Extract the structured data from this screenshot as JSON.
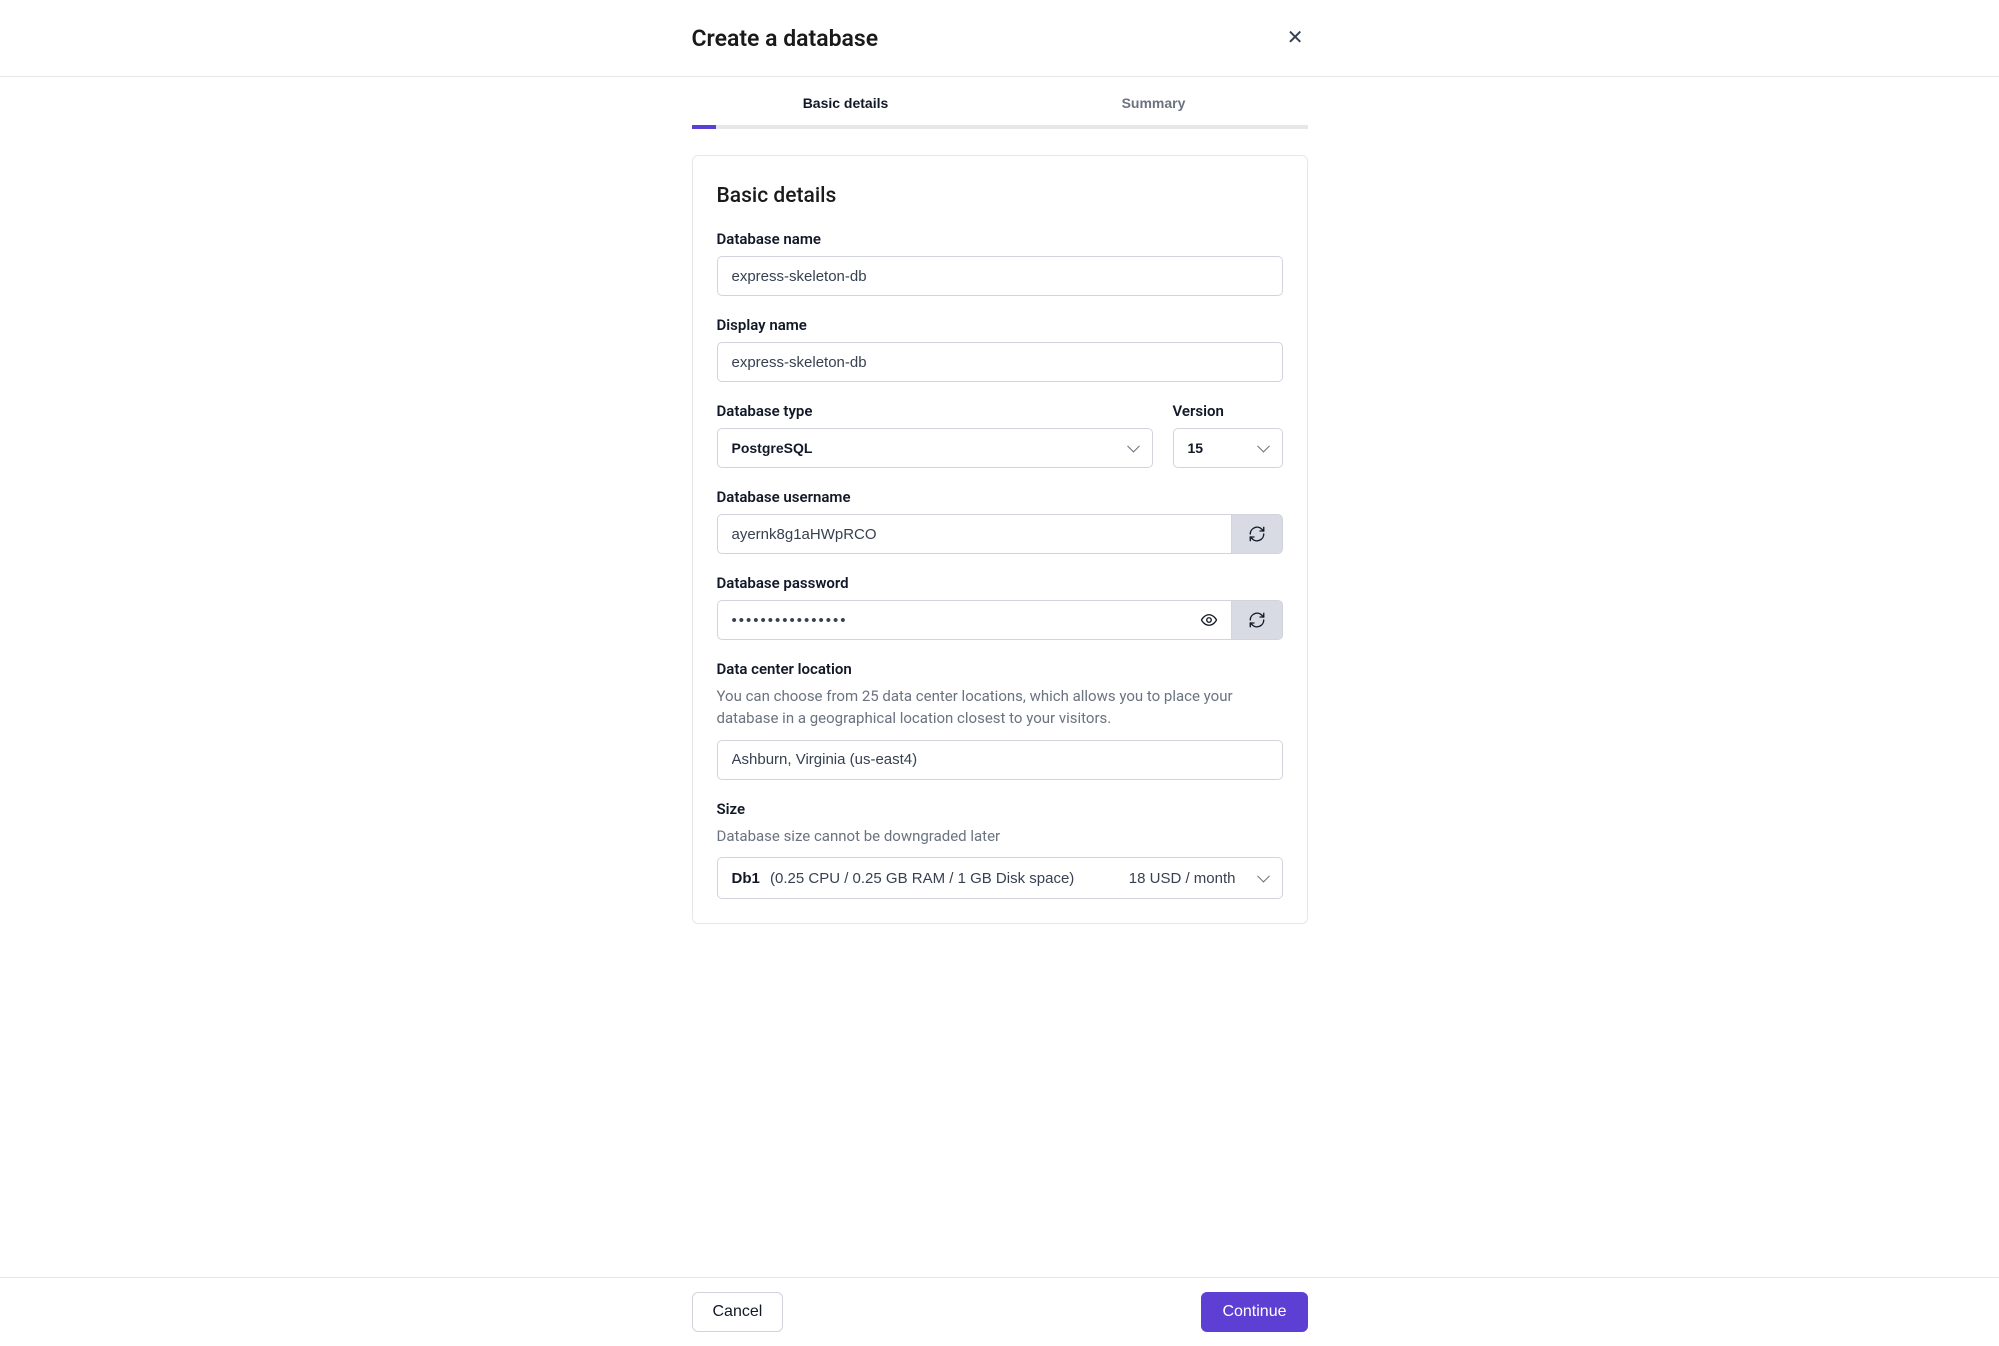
{
  "header": {
    "title": "Create a database"
  },
  "tabs": {
    "basic": "Basic details",
    "summary": "Summary"
  },
  "section": {
    "title": "Basic details"
  },
  "fields": {
    "dbname": {
      "label": "Database name",
      "value": "express-skeleton-db"
    },
    "displayname": {
      "label": "Display name",
      "value": "express-skeleton-db"
    },
    "dbtype": {
      "label": "Database type",
      "value": "PostgreSQL"
    },
    "version": {
      "label": "Version",
      "value": "15"
    },
    "username": {
      "label": "Database username",
      "value": "ayernk8g1aHWpRCO"
    },
    "password": {
      "label": "Database password",
      "value": "••••••••••••••••"
    },
    "location": {
      "label": "Data center location",
      "helper": "You can choose from 25 data center locations, which allows you to place your database in a geographical location closest to your visitors.",
      "value": "Ashburn, Virginia (us-east4)"
    },
    "size": {
      "label": "Size",
      "helper": "Database size cannot be downgraded later",
      "name": "Db1",
      "spec": "(0.25 CPU / 0.25 GB RAM / 1 GB Disk space)",
      "price": "18 USD / month"
    }
  },
  "footer": {
    "cancel": "Cancel",
    "continue": "Continue"
  }
}
